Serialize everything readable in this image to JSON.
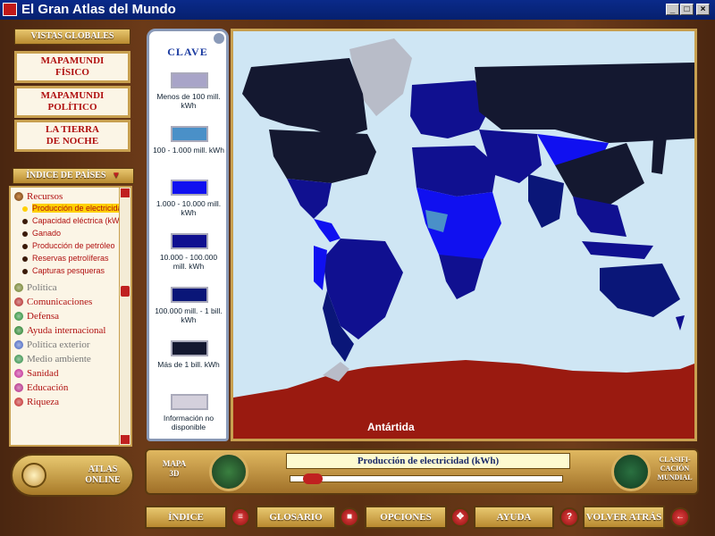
{
  "window": {
    "title": "El Gran Atlas del Mundo",
    "min": "_",
    "max": "□",
    "close": "×"
  },
  "left": {
    "vistas_header": "VISTAS GLOBALES",
    "map_buttons": [
      "MAPAMUNDI\nFÍSICO",
      "MAPAMUNDI\nPOLÍTICO",
      "LA TIERRA\nDE NOCHE"
    ],
    "indice_header": "ÍNDICE DE PAÍSES",
    "categories_top": {
      "label": "Recursos",
      "color": "#8a5a20"
    },
    "sub_items": [
      "Producción de electricidad",
      "Capacidad eléctrica (kW)",
      "Ganado",
      "Producción de petróleo",
      "Reservas petrolíferas",
      "Capturas pesqueras"
    ],
    "selected_sub": 0,
    "categories": [
      {
        "label": "Política",
        "color": "#6a7a20",
        "text": "#777777"
      },
      {
        "label": "Comunicaciones",
        "color": "#b02020",
        "text": "#b01010"
      },
      {
        "label": "Defensa",
        "color": "#208a30",
        "text": "#b01010"
      },
      {
        "label": "Ayuda internacional",
        "color": "#1a7a20",
        "text": "#b01010"
      },
      {
        "label": "Política exterior",
        "color": "#4060c0",
        "text": "#777777"
      },
      {
        "label": "Medio ambiente",
        "color": "#2a8a40",
        "text": "#777777"
      },
      {
        "label": "Sanidad",
        "color": "#c02090",
        "text": "#b01010"
      },
      {
        "label": "Educación",
        "color": "#b02080",
        "text": "#b01010"
      },
      {
        "label": "Riqueza",
        "color": "#c02020",
        "text": "#b01010"
      }
    ],
    "atlas_online": "ATLAS\nONLINE"
  },
  "legend": {
    "title": "CLAVE",
    "items": [
      {
        "label": "Menos de 100 mill. kWh",
        "color": "#a8a4c8"
      },
      {
        "label": "100 - 1.000 mill. kWh",
        "color": "#4a90c8"
      },
      {
        "label": "1.000 - 10.000 mill. kWh",
        "color": "#1010f0"
      },
      {
        "label": "10.000 - 100.000 mill. kWh",
        "color": "#101090"
      },
      {
        "label": "100.000 mill. - 1 bill. kWh",
        "color": "#0a1678"
      },
      {
        "label": "Más de 1 bill. kWh",
        "color": "#141830"
      },
      {
        "label": "Información no disponible",
        "color": "#d4d0dc"
      }
    ]
  },
  "map": {
    "antarctica_label": "Antártida"
  },
  "bottom": {
    "mapa3d": "MAPA\n3D",
    "current_layer": "Producción de electricidad (kWh)",
    "clasificacion": "CLASIFI-\nCACIÓN\nMUNDIAL",
    "nav": [
      "ÍNDICE",
      "GLOSARIO",
      "OPCIONES",
      "AYUDA",
      "VOLVER ATRÁS"
    ]
  }
}
